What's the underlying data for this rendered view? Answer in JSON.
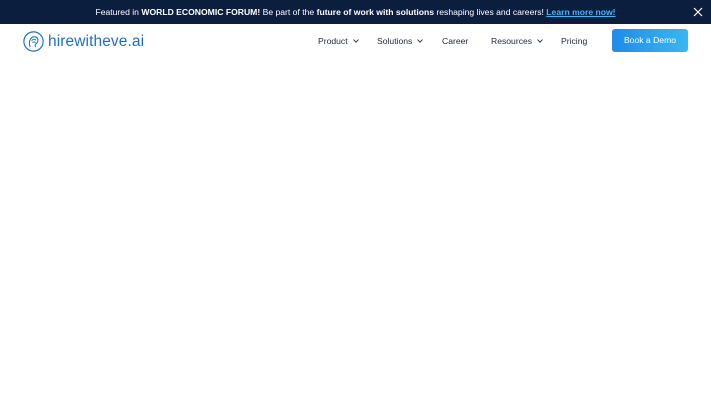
{
  "banner": {
    "prefix": "Featured in ",
    "emphasis1": "WORLD ECONOMIC FORUM!",
    "middle": " Be part of the ",
    "emphasis2": "future of work with solutions",
    "suffix": " reshaping lives and careers! ",
    "link": "Learn more now!",
    "close_icon": "close-icon"
  },
  "header": {
    "logo_text": "hirewitheve.ai",
    "logo_icon": "eve-head-logo-icon",
    "nav": {
      "product": "Product",
      "solutions": "Solutions",
      "career": "Career",
      "resources": "Resources",
      "pricing": "Pricing"
    },
    "cta": "Book a Demo"
  },
  "colors": {
    "banner_bg": "#0b1e3e",
    "banner_link": "#3db8ff",
    "brand": "#1e6ec8",
    "cta_gradient": [
      "#1e8ce8",
      "#3ab7f0"
    ]
  }
}
